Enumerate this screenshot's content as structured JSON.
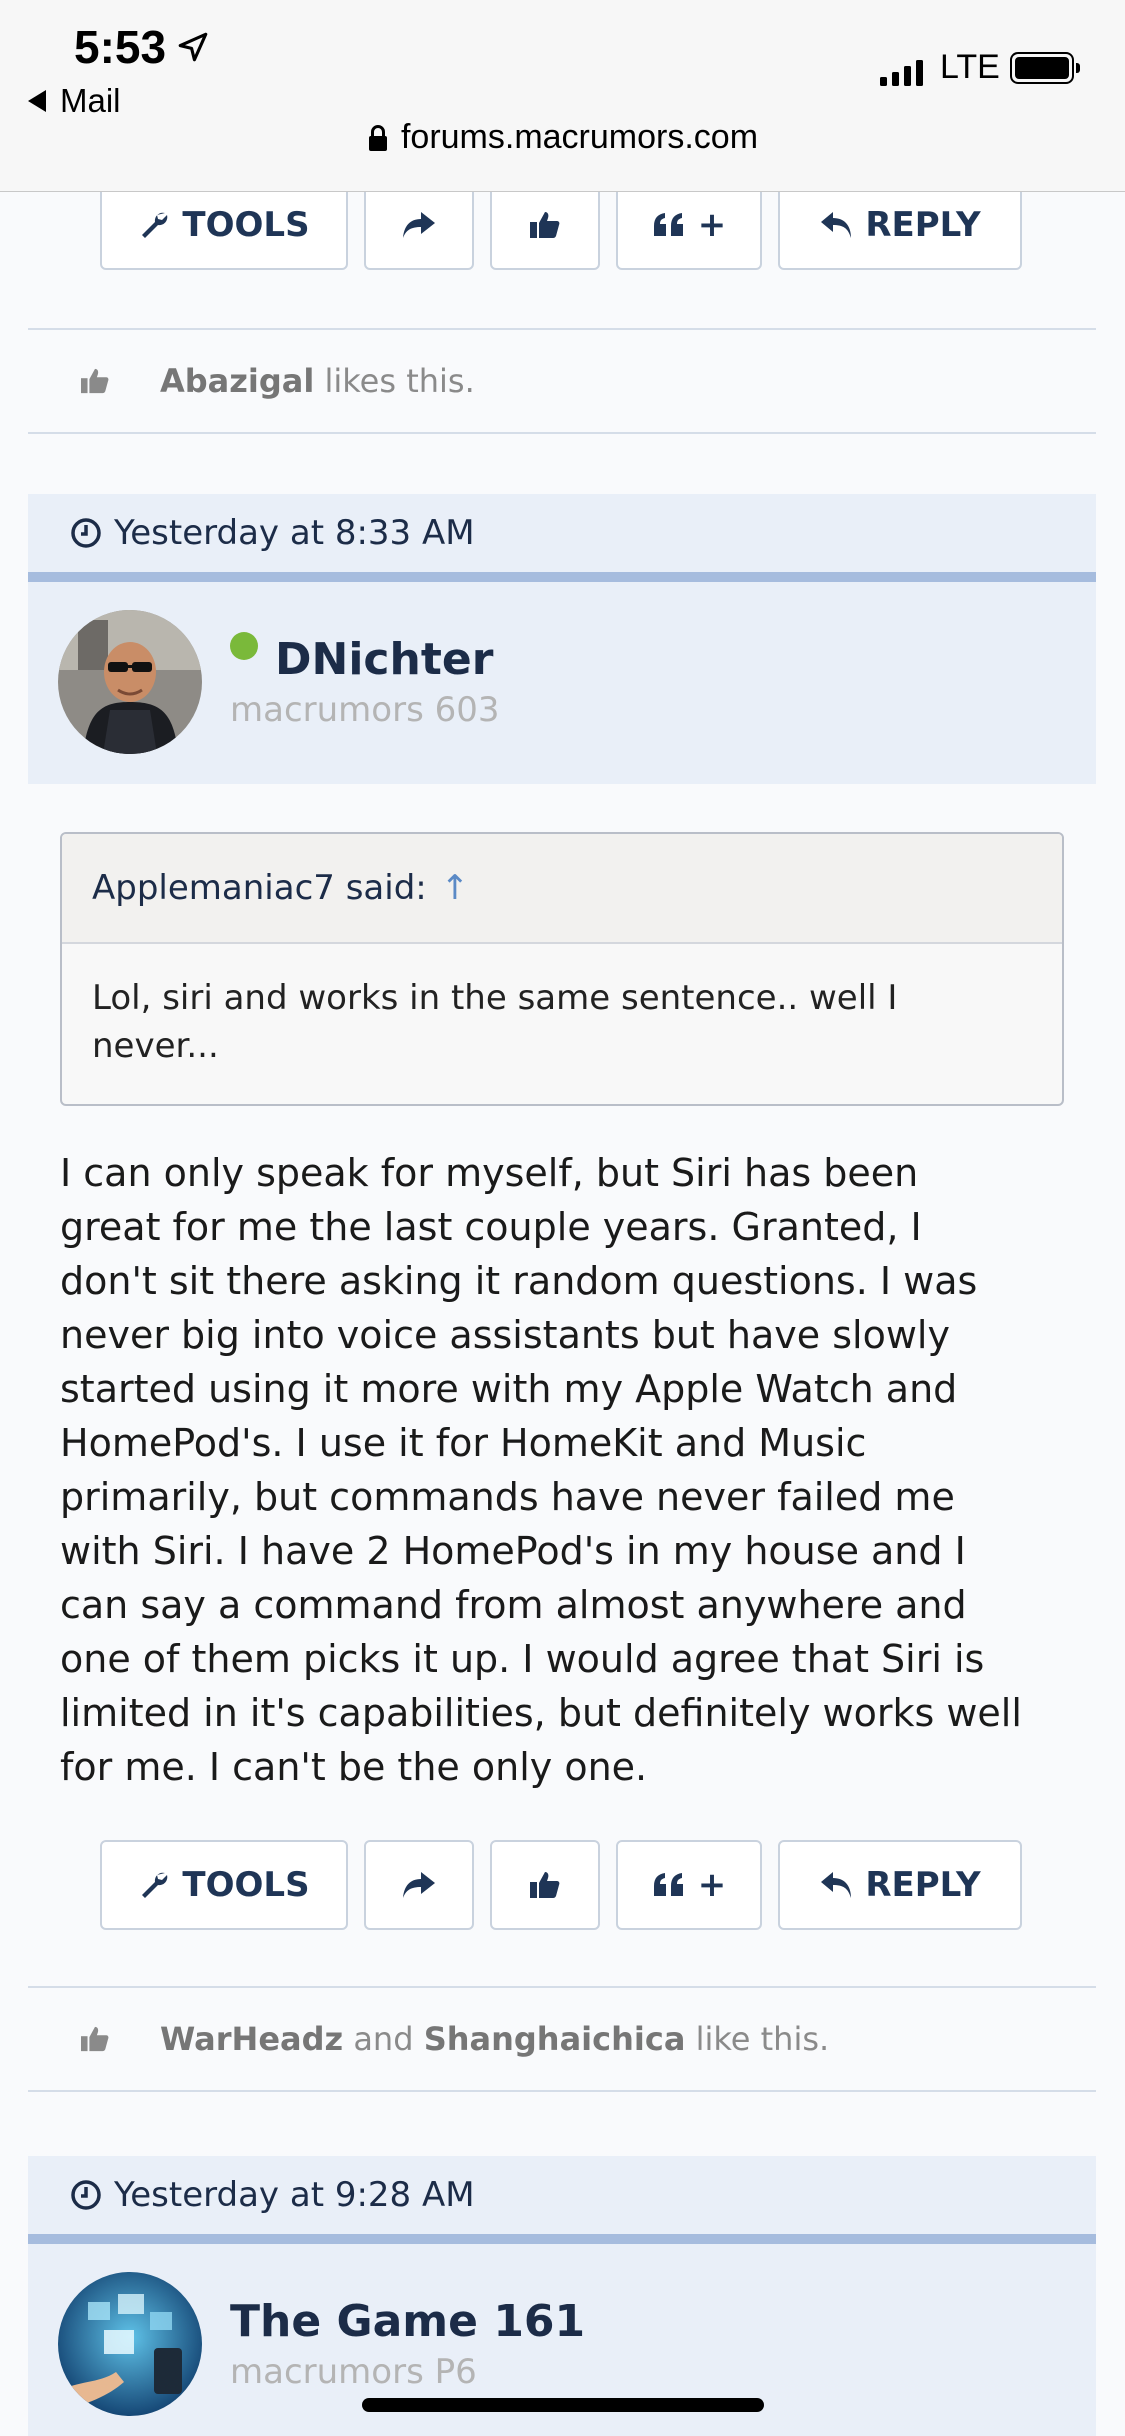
{
  "status_bar": {
    "time": "5:53",
    "back_app": "Mail",
    "network": "LTE"
  },
  "browser": {
    "url": "forums.macrumors.com"
  },
  "actions": {
    "tools": "TOOLS",
    "reply": "REPLY",
    "quote_plus": "+"
  },
  "post1_likes": {
    "user": "Abazigal",
    "suffix": "likes this."
  },
  "post2": {
    "date": "Yesterday at 8:33 AM",
    "username": "DNichter",
    "rank": "macrumors 603",
    "quote_author": "Applemaniac7 said:",
    "quote_arrow": "↑",
    "quote_text": "Lol, siri and works in the same sentence.. well I never...",
    "body_lines": [
      "I can only speak for myself, but Siri has been",
      "great for me the last couple years. Granted, I",
      "don't sit there asking it random questions. I was",
      "never big into voice assistants but have slowly",
      "started using it more with my Apple Watch and",
      "HomePod's. I use it for HomeKit and Music",
      "primarily, but commands have never failed me",
      "with Siri. I have 2 HomePod's in my house and I",
      "can say a command from almost anywhere and",
      "one of them picks it up. I would agree that Siri is",
      "limited in it's capabilities, but definitely works well",
      "for me. I can't be the only one."
    ],
    "likes": {
      "user1": "WarHeadz",
      "and": "and",
      "user2": "Shanghaichica",
      "suffix": "like this."
    }
  },
  "post3": {
    "date": "Yesterday at 9:28 AM",
    "username": "The Game 161",
    "rank": "macrumors P6"
  },
  "colors": {
    "accent_navy": "#1c2c48",
    "date_bar_bg": "#e9eff8",
    "date_bar_border": "#a6bcde",
    "online": "#7ab93a"
  }
}
